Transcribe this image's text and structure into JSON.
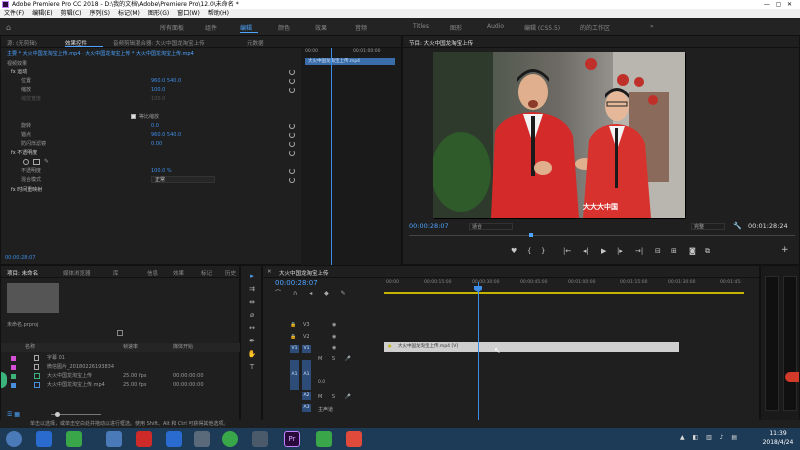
{
  "window": {
    "title": "Adobe Premiere Pro CC 2018 - D:\\我的文档\\Adobe\\Premiere Pro\\12.0\\未命名 *"
  },
  "menu": [
    "文件(F)",
    "编辑(E)",
    "剪辑(C)",
    "序列(S)",
    "标记(M)",
    "图形(G)",
    "窗口(W)",
    "帮助(H)"
  ],
  "workspaces": [
    "所有面板",
    "组件",
    "编辑",
    "颜色",
    "效果",
    "音频",
    "Titles",
    "图形",
    "Audio",
    "编辑 (CS5.5)",
    "的的工作区"
  ],
  "source_panel": {
    "tabs": [
      "源: (无剪辑)",
      "效果控件",
      "音频剪辑混合器: 大火中国龙淘宝上传",
      "元数据"
    ],
    "header": "主要 * 大火中国龙淘宝上传.mp4 · 大火中国龙淘宝上传 * 大火中国龙淘宝上传.mp4",
    "clip_header": "视频效果",
    "clip_name": "大火中国龙淘宝上传.mp4",
    "ruler_start": "00:00",
    "ruler_end": "00:01:00:00",
    "rows": [
      {
        "label": "fx 运动",
        "value": ""
      },
      {
        "label": "位置",
        "value": "960.0   540.0"
      },
      {
        "label": "缩放",
        "value": "100.0"
      },
      {
        "label": "缩放宽度",
        "value": "100.0"
      },
      {
        "label": "",
        "value": "等比缩放"
      },
      {
        "label": "旋转",
        "value": "0.0"
      },
      {
        "label": "锚点",
        "value": "960.0   540.0"
      },
      {
        "label": "防闪烁滤镜",
        "value": "0.00"
      },
      {
        "label": "fx 不透明度",
        "value": ""
      },
      {
        "label": "",
        "value": ""
      },
      {
        "label": "不透明度",
        "value": "100.0 %"
      },
      {
        "label": "混合模式",
        "value": "正常"
      },
      {
        "label": "fx 时间重映射",
        "value": ""
      }
    ],
    "timecode": "00:00:28:07"
  },
  "program_panel": {
    "title": "节目: 大火中国龙淘宝上传",
    "caption": "大大大中国",
    "timecode_left": "00:00:28:07",
    "fit": "适合",
    "quality": "完整",
    "timecode_right": "00:01:28:24",
    "controls": [
      "marker-icon",
      "in-icon",
      "out-icon",
      "goto-in-icon",
      "step-back-icon",
      "play-icon",
      "step-forward-icon",
      "goto-out-icon",
      "lift-icon",
      "extract-icon",
      "export-frame-icon",
      "button-editor-icon"
    ]
  },
  "project_panel": {
    "tabs": [
      "项目: 未命名",
      "媒体浏览器",
      "库",
      "信息",
      "效果",
      "标记",
      "历史"
    ],
    "project_file": "未命名.prproj",
    "columns": [
      "名称",
      "帧速率",
      "媒体开始"
    ],
    "items": [
      {
        "name": "字幕 01",
        "fps": "",
        "start": "",
        "color": "#d54fd5"
      },
      {
        "name": "微信图片_20180226193834",
        "fps": "",
        "start": "",
        "color": "#d54fd5"
      },
      {
        "name": "大火中国龙淘宝上传",
        "fps": "25.00 fps",
        "start": "00:00:00:00",
        "color": "#3cb37a"
      },
      {
        "name": "大火中国龙淘宝上传.mp4",
        "fps": "25.00 fps",
        "start": "00:00:00:00",
        "color": "#4a8ede"
      }
    ]
  },
  "timeline": {
    "title": "大火中国龙淘宝上传",
    "timecode": "00:00:28:07",
    "ruler": [
      "00:00",
      "00:00:15:00",
      "00:00:30:00",
      "00:00:45:00",
      "00:01:00:00",
      "00:01:15:00",
      "00:01:30:00",
      "00:01:45:"
    ],
    "tracks": [
      "V3",
      "V2",
      "V1",
      "A1",
      "A2",
      "A3"
    ],
    "master": "主声道",
    "clip_label": "大火中国龙淘宝上传.mp4 [V]",
    "mix_value": "0.0"
  },
  "status_bar": "单击以选择，或单击空白处并拖动以进行框选。使用 Shift、Alt 和 Ctrl 可获得其他选项。",
  "taskbar": {
    "time": "11:39",
    "date": "2018/4/24"
  }
}
